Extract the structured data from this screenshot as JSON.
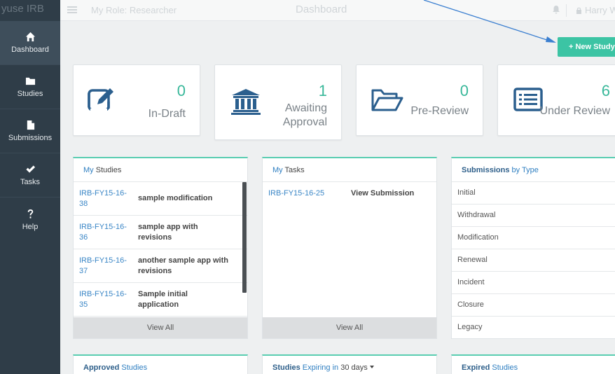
{
  "sidebar": {
    "brand": "yuse IRB",
    "items": [
      {
        "label": "Dashboard",
        "icon": "home-icon"
      },
      {
        "label": "Studies",
        "icon": "folder-icon"
      },
      {
        "label": "Submissions",
        "icon": "file-icon"
      },
      {
        "label": "Tasks",
        "icon": "check-icon"
      },
      {
        "label": "Help",
        "icon": "question-icon"
      }
    ]
  },
  "topbar": {
    "role": "My Role: Researcher",
    "title": "Dashboard",
    "user": "Harry W"
  },
  "new_study_button": "+ New Study",
  "stats": [
    {
      "count": "0",
      "label": "In-Draft",
      "icon": "edit-icon"
    },
    {
      "count": "1",
      "label_line1": "Awaiting",
      "label_line2": "Approval",
      "icon": "institution-icon"
    },
    {
      "count": "0",
      "label": "Pre-Review",
      "icon": "folder-open-icon"
    },
    {
      "count": "6",
      "label": "Under Review",
      "icon": "list-icon"
    }
  ],
  "my_studies": {
    "title_prefix": "My",
    "title_rest": " Studies",
    "rows": [
      {
        "id_line1": "IRB-FY15-16-",
        "id_line2": "38",
        "name": "sample modification"
      },
      {
        "id_line1": "IRB-FY15-16-",
        "id_line2": "36",
        "name": "sample app with revisions"
      },
      {
        "id_line1": "IRB-FY15-16-",
        "id_line2": "37",
        "name_line1": "another sample app with",
        "name_line2": "revisions"
      },
      {
        "id_line1": "IRB-FY15-16-",
        "id_line2": "35",
        "name": "Sample initial application"
      }
    ],
    "view_all": "View All"
  },
  "my_tasks": {
    "title_prefix": "My",
    "title_rest": " Tasks",
    "rows": [
      {
        "id": "IRB-FY15-16-25",
        "action": "View Submission"
      }
    ],
    "view_all": "View All"
  },
  "submissions_by_type": {
    "title_bold": "Submissions",
    "title_rest": " by Type",
    "types": [
      "Initial",
      "Withdrawal",
      "Modification",
      "Renewal",
      "Incident",
      "Closure",
      "Legacy"
    ]
  },
  "bottom_panels": {
    "approved": {
      "bold": "Approved",
      "rest": " Studies"
    },
    "expiring": {
      "bold": "Studies",
      "rest": " Expiring in",
      "select": "30 days"
    },
    "expired": {
      "bold": "Expired",
      "rest": " Studies"
    }
  },
  "colors": {
    "sidebar": "#2f3d48",
    "accent": "#3cc4a4",
    "count": "#39b89a",
    "link": "#3a86c6",
    "icon": "#2b5f8e",
    "arrow": "#3b7fd0"
  }
}
